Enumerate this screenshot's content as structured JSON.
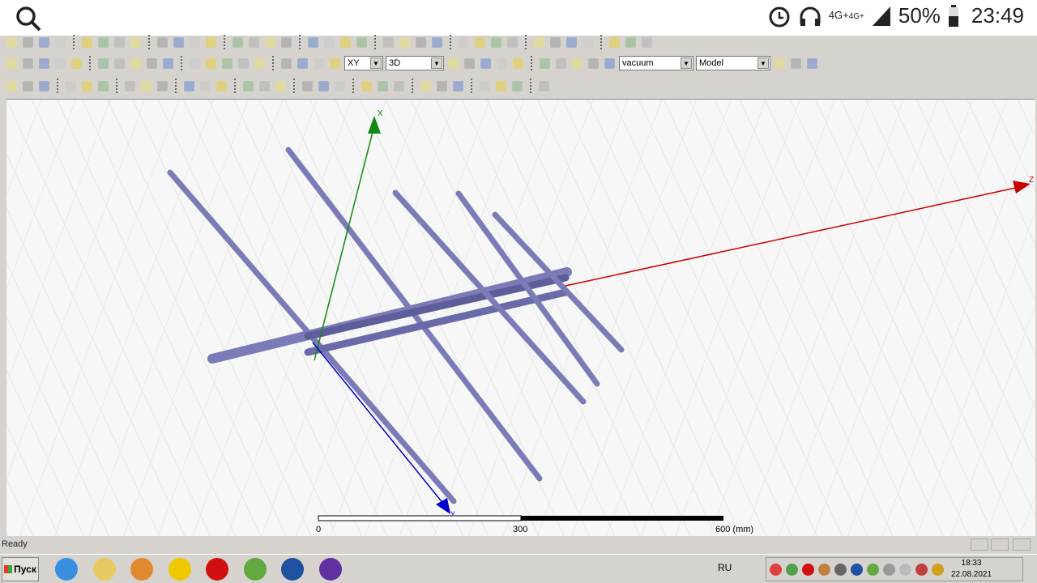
{
  "phone_status": {
    "network": "4G+",
    "network2": "4G+",
    "battery": "50%",
    "time": "23:49",
    "icons": [
      "search-icon",
      "alarm-icon",
      "headphones-icon",
      "signal-icon",
      "battery-icon"
    ]
  },
  "toolbar": {
    "row1_icons": [
      "new-icon",
      "open-icon",
      "save-icon",
      "cut-icon",
      "copy-icon",
      "paste-icon",
      "print-icon",
      "undo-icon",
      "redo1-icon",
      "redo2-icon",
      "select-icon",
      "move-icon",
      "rotate-icon",
      "validate-icon",
      "check-icon",
      "analyze-icon",
      "results-icon",
      "zoom-icon",
      "plot-icon",
      "fit-icon",
      "pan-icon",
      "rotate-view-icon",
      "orbit-icon",
      "zoom-in-icon",
      "zoom-out-icon",
      "zoom-window-icon",
      "zoom-all-icon",
      "measure-icon",
      "ruler-icon",
      "align-icon",
      "mirror-icon",
      "view-icon",
      "view2-icon",
      "view3-icon",
      "view4-icon"
    ],
    "row2_icons": [
      "help-icon",
      "context-help-icon",
      "rectangle-icon",
      "circle-icon",
      "polygon-icon",
      "ellipse-icon",
      "region-icon",
      "box-icon",
      "cylinder-icon",
      "regular-cylinder-icon",
      "cone-icon",
      "sphere-icon",
      "torus-icon",
      "helix-icon",
      "spiral-icon",
      "bondwire-icon",
      "point-icon",
      "plane-icon",
      "cs-icon"
    ],
    "plane_select": "XY",
    "dim_select": "3D",
    "material_select": "vacuum",
    "model_select": "Model",
    "row2b_icons": [
      "unite-icon",
      "subtract-icon",
      "intersect-icon",
      "split-icon",
      "imprint-icon",
      "sweep-icon",
      "thicken-icon",
      "mirror-obj-icon",
      "local-cs-icon",
      "face-cs-icon",
      "material-icon",
      "fill-icon",
      "fill2-icon"
    ],
    "row3_icons": [
      "grid-icon",
      "ruler-snap-icon",
      "paint-icon",
      "snap-grid-icon",
      "snap-face-icon",
      "snap-edge-icon",
      "snap-center-icon",
      "snap-vertex-icon",
      "arc-icon",
      "obj1-icon",
      "obj2-icon",
      "obj3-icon",
      "obj4-icon",
      "obj5-icon",
      "obj6-icon",
      "obj7-icon",
      "obj8-icon",
      "obj9-icon",
      "network-icon",
      "render-icon",
      "antenna-icon",
      "field1-icon",
      "field2-icon",
      "field3-icon",
      "field4-icon",
      "field5-icon",
      "field6-icon",
      "field7-icon"
    ]
  },
  "viewport": {
    "axes": {
      "x": "X",
      "y": "Y",
      "z": "Z"
    },
    "axis_colors": {
      "x": "#118811",
      "y": "#0000cc",
      "z": "#cc0000"
    },
    "model_color": "#7b7bb8",
    "scale": {
      "ticks": [
        "0",
        "300",
        "600 (mm)"
      ]
    }
  },
  "status": {
    "text": "Ready"
  },
  "taskbar": {
    "start": "Пуск",
    "apps": [
      "ie-icon",
      "explorer-icon",
      "media-player-icon",
      "yandex-icon",
      "opera-icon",
      "utorrent-icon",
      "save-app-icon",
      "hfss-icon"
    ],
    "lang": "RU",
    "tray_icons": [
      "tray-1-icon",
      "tray-2-icon",
      "tray-opera-icon",
      "tray-volume-icon",
      "tray-display-icon",
      "tray-monitor-icon",
      "tray-utorrent-icon",
      "tray-power-icon",
      "tray-sound-icon",
      "tray-flag-icon",
      "tray-network-icon"
    ],
    "time": "18:33",
    "date": "22.08.2021"
  }
}
